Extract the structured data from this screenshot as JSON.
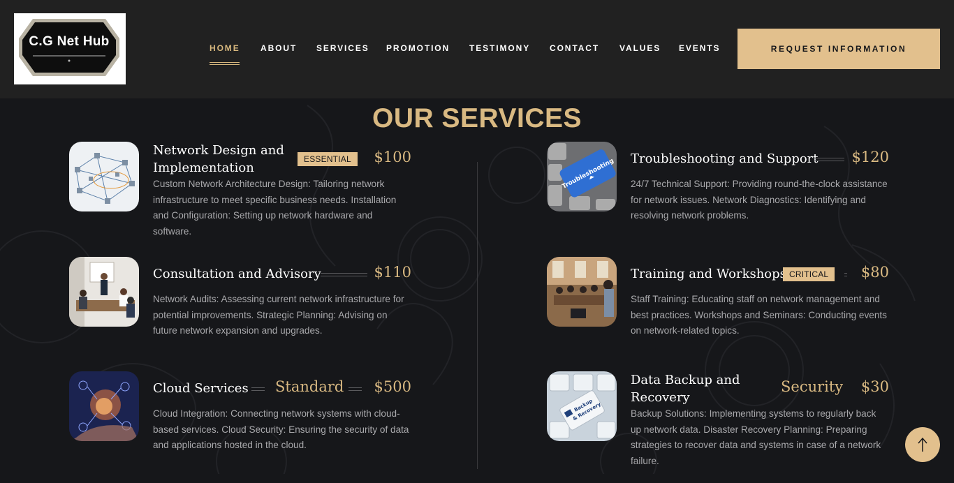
{
  "logo": {
    "text": "C.G Net Hub"
  },
  "nav": {
    "items": [
      {
        "label": "HOME",
        "active": true
      },
      {
        "label": "ABOUT"
      },
      {
        "label": "SERVICES"
      },
      {
        "label": "PROMOTION"
      },
      {
        "label": "TESTIMONY"
      },
      {
        "label": "CONTACT"
      },
      {
        "label": "VALUES"
      },
      {
        "label": "EVENTS"
      }
    ],
    "cta_label": "REQUEST INFORMATION"
  },
  "section": {
    "title": "OUR SERVICES"
  },
  "services": [
    {
      "name_line1": "Network Design and",
      "name_line2": "Implementation",
      "badge": "ESSENTIAL",
      "price": "$100",
      "description": "Custom Network Architecture Design: Tailoring network infrastructure to meet specific business needs. Installation and Configuration: Setting up network hardware and software.",
      "image": "network-diagram-image"
    },
    {
      "name_line1": "Troubleshooting and Support",
      "price": "$120",
      "description": "24/7 Technical Support: Providing round-the-clock assistance for network issues. Network Diagnostics: Identifying and resolving network problems.",
      "image": "troubleshooting-key-image"
    },
    {
      "name_line1": "Consultation and Advisory",
      "price": "$110",
      "description": "Network Audits: Assessing current network infrastructure for potential improvements. Strategic Planning: Advising on future network expansion and upgrades.",
      "image": "meeting-image"
    },
    {
      "name_line1": "Training and Workshops",
      "badge": "CRITICAL",
      "price": "$80",
      "description": "Staff Training: Educating staff on network management and best practices. Workshops and Seminars: Conducting events on network-related topics.",
      "image": "classroom-image"
    },
    {
      "name_line1": "Cloud Services",
      "tag": "Standard",
      "price": "$500",
      "description": "Cloud Integration: Connecting network systems with cloud-based services. Cloud Security: Ensuring the security of data and applications hosted in the cloud.",
      "image": "cloud-hand-image"
    },
    {
      "name_line1": "Data Backup and",
      "name_line2": "Recovery",
      "tag": "Security",
      "price": "$30",
      "description": "Backup Solutions: Implementing systems to regularly back up network data. Disaster Recovery Planning: Preparing strategies to recover data and systems in case of a network failure.",
      "image": "backup-key-image"
    }
  ],
  "colors": {
    "accent": "#e2c08d",
    "background": "#16171a",
    "header": "#212121"
  }
}
